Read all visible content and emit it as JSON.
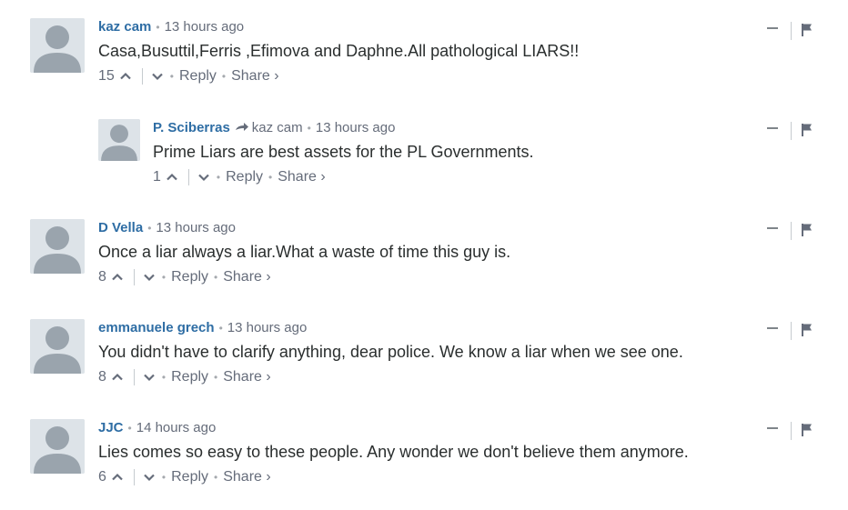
{
  "comments": [
    {
      "author": "kaz cam",
      "reply_to": "",
      "time": "13 hours ago",
      "text": "Casa,Busuttil,Ferris ,Efimova and Daphne.All pathological LIARS!!",
      "votes": "15",
      "reply_label": "Reply",
      "share_label": "Share ›"
    },
    {
      "author": "P. Sciberras",
      "reply_to": "kaz cam",
      "time": "13 hours ago",
      "text": "Prime Liars are best assets for the PL Governments.",
      "votes": "1",
      "reply_label": "Reply",
      "share_label": "Share ›"
    },
    {
      "author": "D Vella",
      "reply_to": "",
      "time": "13 hours ago",
      "text": "Once a liar always a liar.What a waste of time this guy is.",
      "votes": "8",
      "reply_label": "Reply",
      "share_label": "Share ›"
    },
    {
      "author": "emmanuele grech",
      "reply_to": "",
      "time": "13 hours ago",
      "text": "You didn't have to clarify anything, dear police. We know a liar when we see one.",
      "votes": "8",
      "reply_label": "Reply",
      "share_label": "Share ›"
    },
    {
      "author": "JJC",
      "reply_to": "",
      "time": "14 hours ago",
      "text": "Lies comes so easy to these people. Any wonder we don't believe them anymore.",
      "votes": "6",
      "reply_label": "Reply",
      "share_label": "Share ›"
    }
  ],
  "colors": {
    "author": "#2e6da4",
    "meta": "#656c7a",
    "text": "#2a2e2e",
    "avatar_bg": "#dde3e8",
    "avatar_fg": "#9aa4ad"
  },
  "icons": [
    "avatar",
    "reply-arrow-icon",
    "upvote-icon",
    "downvote-icon",
    "collapse-icon",
    "flag-icon"
  ]
}
